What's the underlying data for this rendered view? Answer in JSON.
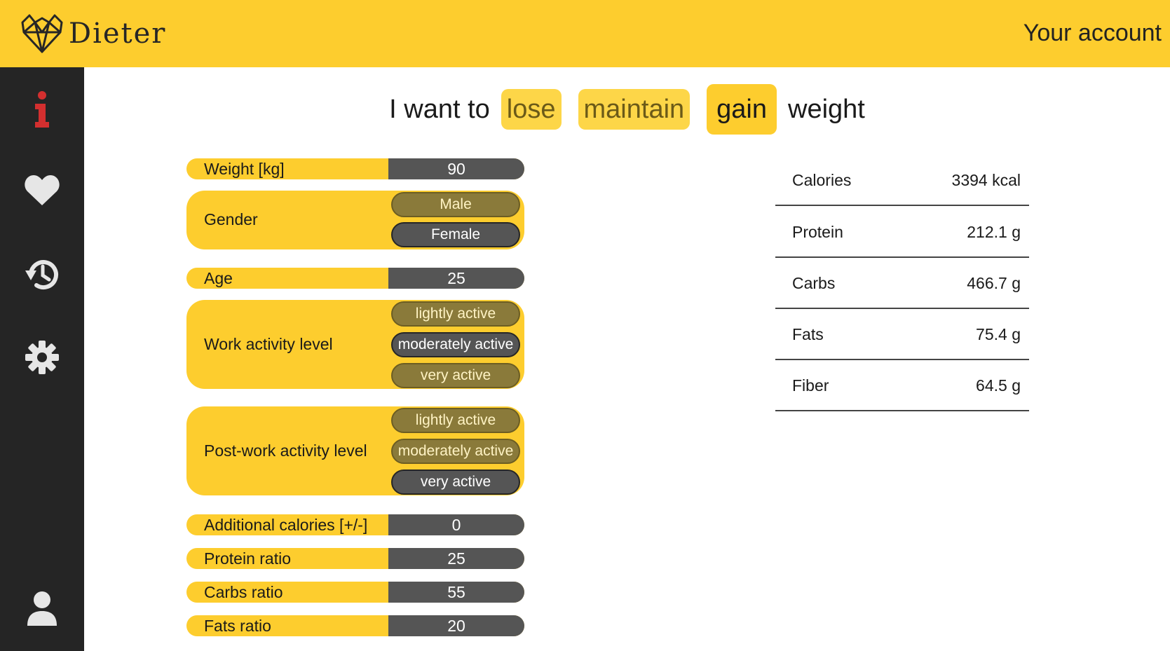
{
  "header": {
    "brand": "Dieter",
    "account_label": "Your account"
  },
  "sidebar": {
    "items": [
      {
        "icon": "info-icon",
        "color": "#d32f2f"
      },
      {
        "icon": "heart-icon",
        "color": "#e6e6e6"
      },
      {
        "icon": "history-icon",
        "color": "#e6e6e6"
      },
      {
        "icon": "gear-icon",
        "color": "#e6e6e6"
      },
      {
        "icon": "user-icon",
        "color": "#e6e6e6"
      }
    ]
  },
  "goal": {
    "prefix": "I want to",
    "options": [
      "lose",
      "maintain",
      "gain"
    ],
    "selected": "gain",
    "suffix": "weight"
  },
  "form": {
    "weight": {
      "label": "Weight [kg]",
      "value": "90"
    },
    "gender": {
      "label": "Gender",
      "options": [
        "Male",
        "Female"
      ],
      "selected": "Female"
    },
    "age": {
      "label": "Age",
      "value": "25"
    },
    "work_activity": {
      "label": "Work activity level",
      "options": [
        "lightly active",
        "moderately active",
        "very active"
      ],
      "selected": "moderately active"
    },
    "post_work_activity": {
      "label": "Post-work activity level",
      "options": [
        "lightly active",
        "moderately active",
        "very active"
      ],
      "selected": "very active"
    },
    "additional_calories": {
      "label": "Additional calories [+/-]",
      "value": "0"
    },
    "protein_ratio": {
      "label": "Protein ratio",
      "value": "25"
    },
    "carbs_ratio": {
      "label": "Carbs ratio",
      "value": "55"
    },
    "fats_ratio": {
      "label": "Fats ratio",
      "value": "20"
    }
  },
  "results": [
    {
      "name": "Calories",
      "value": "3394 kcal"
    },
    {
      "name": "Protein",
      "value": "212.1 g"
    },
    {
      "name": "Carbs",
      "value": "466.7 g"
    },
    {
      "name": "Fats",
      "value": "75.4 g"
    },
    {
      "name": "Fiber",
      "value": "64.5 g"
    }
  ],
  "colors": {
    "accent": "#fdcd2e",
    "sidebar": "#252525",
    "input": "#555555",
    "option_inactive": "#8a7a3a"
  }
}
